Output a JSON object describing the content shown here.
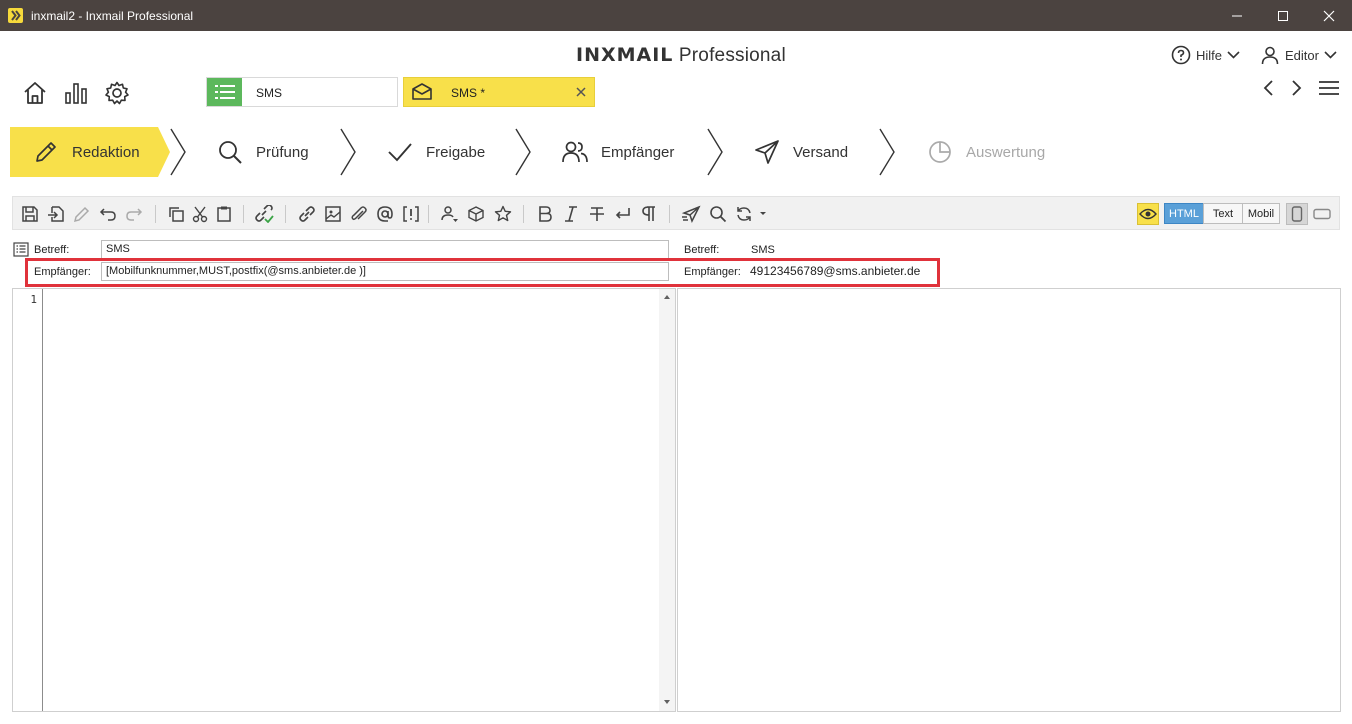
{
  "window": {
    "title": "inxmail2 - Inxmail Professional"
  },
  "header": {
    "brand_bold": "INXMAIL",
    "brand_light": "Professional",
    "help_label": "Hilfe",
    "user_label": "Editor"
  },
  "tabs": [
    {
      "label": "SMS",
      "icon": "list-icon",
      "color": "#5cb85c"
    },
    {
      "label": "SMS *",
      "icon": "envelope-icon",
      "color": "#f8e04a"
    }
  ],
  "workflow": {
    "steps": [
      {
        "label": "Redaktion",
        "icon": "pencil-icon"
      },
      {
        "label": "Prüfung",
        "icon": "magnifier-icon"
      },
      {
        "label": "Freigabe",
        "icon": "checkmark-icon"
      },
      {
        "label": "Empfänger",
        "icon": "users-icon"
      },
      {
        "label": "Versand",
        "icon": "paper-plane-icon"
      },
      {
        "label": "Auswertung",
        "icon": "pie-chart-icon"
      }
    ],
    "active_color": "#f8e04a"
  },
  "toolbar": {
    "view_modes": [
      "HTML",
      "Text",
      "Mobil"
    ],
    "active_view": "HTML"
  },
  "fields": {
    "subject_label": "Betreff:",
    "subject_value": "SMS",
    "recipient_label": "Empfänger:",
    "recipient_value": "[Mobilfunknummer,MUST,postfix(@sms.anbieter.de )]"
  },
  "preview": {
    "subject_label": "Betreff:",
    "subject_value": "SMS",
    "recipient_label": "Empfänger:",
    "recipient_value": "49123456789@sms.anbieter.de"
  },
  "editor": {
    "line_number": "1"
  }
}
